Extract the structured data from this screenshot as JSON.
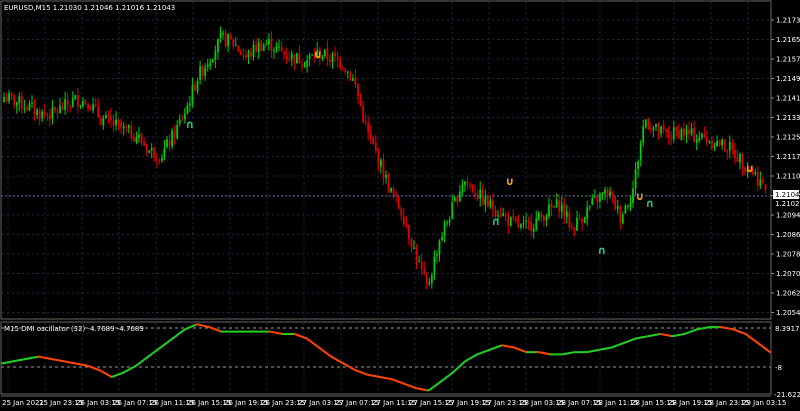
{
  "window": {
    "main_title": "EURUSD,M15  1.21030 1.21046 1.21016 1.21043",
    "sub_title": "M15 DMI oscillator (32) -4.7689 -4.7689"
  },
  "colors": {
    "background": "#000000",
    "grid": "#1e2a40",
    "bull": "#00d000",
    "bear": "#e00000",
    "osc_up": "#22cc22",
    "osc_down": "#ff4400",
    "arrow_up": "#22cc88",
    "arrow_down": "#ffaa00",
    "text": "#ffffff"
  },
  "price_axis": {
    "labels": [
      "1.21735",
      "1.21655",
      "1.21575",
      "1.21495",
      "1.21415",
      "1.21335",
      "1.21255",
      "1.21175",
      "1.21100",
      "1.21020",
      "1.20940",
      "1.20860",
      "1.20780",
      "1.20700",
      "1.20625",
      "1.20545"
    ],
    "current_bid": "1.21043",
    "current_ask": "1.21020"
  },
  "osc_axis": {
    "labels": [
      "8.3917",
      "-8",
      "-21.6226"
    ]
  },
  "time_axis": {
    "labels": [
      "25 Jan 2021",
      "25 Jan 23:15",
      "26 Jan 03:15",
      "26 Jan 07:15",
      "26 Jan 11:15",
      "26 Jan 15:15",
      "26 Jan 19:15",
      "26 Jan 23:15",
      "27 Jan 03:15",
      "27 Jan 07:15",
      "27 Jan 11:15",
      "27 Jan 15:15",
      "27 Jan 19:15",
      "27 Jan 23:15",
      "28 Jan 03:15",
      "28 Jan 07:15",
      "28 Jan 11:15",
      "28 Jan 15:15",
      "28 Jan 19:15",
      "28 Jan 23:15",
      "29 Jan 03:15"
    ]
  },
  "chart_data": {
    "type": "candlestick",
    "symbol": "EURUSD",
    "timeframe": "M15",
    "ylim": [
      1.2054,
      1.2178
    ],
    "price_path": [
      1.2144,
      1.2142,
      1.214,
      1.2137,
      1.2137,
      1.214,
      1.2143,
      1.2142,
      1.2135,
      1.2133,
      1.213,
      1.2128,
      1.2122,
      1.212,
      1.2128,
      1.2138,
      1.2152,
      1.216,
      1.2168,
      1.2166,
      1.216,
      1.2165,
      1.2166,
      1.2162,
      1.216,
      1.2159,
      1.2162,
      1.216,
      1.2158,
      1.215,
      1.213,
      1.2118,
      1.2105,
      1.2096,
      1.208,
      1.2065,
      1.2085,
      1.2097,
      1.211,
      1.2105,
      1.21,
      1.2097,
      1.2092,
      1.209,
      1.2093,
      1.2097,
      1.21,
      1.209,
      1.2096,
      1.2102,
      1.2105,
      1.2095,
      1.2105,
      1.2135,
      1.213,
      1.2128,
      1.213,
      1.2128,
      1.2127,
      1.2125,
      1.2123,
      1.2118,
      1.2113,
      1.2106
    ],
    "oscillator": [
      -9,
      -8,
      -7,
      -6,
      -7,
      -8,
      -9,
      -10,
      -12,
      -15,
      -13,
      -10,
      -6,
      -2,
      2,
      6,
      8.3,
      7,
      5,
      5,
      5,
      5,
      5,
      4,
      4,
      2,
      -2,
      -6,
      -9,
      -12,
      -14,
      -15,
      -16,
      -18,
      -20,
      -21,
      -17,
      -13,
      -8,
      -5,
      -3,
      -1,
      -2,
      -4,
      -4,
      -5,
      -5,
      -4,
      -4,
      -3,
      -2,
      0,
      2,
      3,
      4,
      3,
      4,
      6,
      7,
      7,
      6,
      4,
      0,
      -4
    ]
  },
  "signals": {
    "up": [
      {
        "label": "up-arrow"
      },
      {
        "label": "up-arrow"
      },
      {
        "label": "up-arrow"
      },
      {
        "label": "up-arrow"
      }
    ],
    "down": [
      {
        "label": "down-arrow"
      },
      {
        "label": "down-arrow"
      },
      {
        "label": "down-arrow"
      },
      {
        "label": "down-arrow"
      }
    ]
  }
}
